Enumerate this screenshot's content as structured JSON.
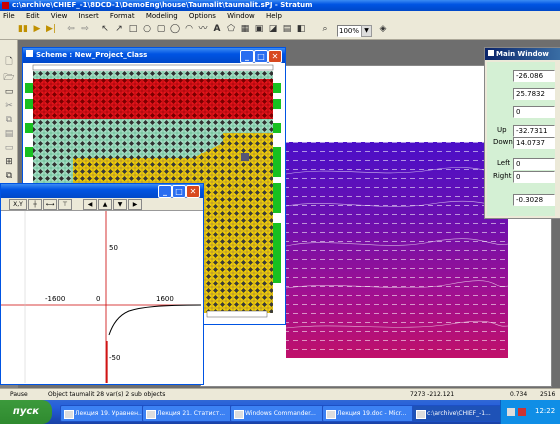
{
  "app": {
    "title": "c:\\archive\\CHIEF_-1\\8DCD-1\\DemoEng\\house\\Taumalit\\taumalit.sPJ - Stratum"
  },
  "menu": [
    "File",
    "Edit",
    "View",
    "Insert",
    "Format",
    "Modeling",
    "Options",
    "Window",
    "Help"
  ],
  "toolbar": {
    "zoom": "100%"
  },
  "scheme_window": {
    "title": "Scheme : New_Project_Class"
  },
  "graph_window": {
    "toolbar_label": "X,Y",
    "x_ticks": [
      "-1600",
      "0",
      "1600"
    ],
    "y_ticks": [
      "50",
      "-50"
    ]
  },
  "main_window": {
    "title": "Main Window",
    "fields": [
      {
        "label": "",
        "value": "-26.086"
      },
      {
        "label": "",
        "value": "25.7832"
      },
      {
        "label": "",
        "value": "0"
      },
      {
        "label": "Up",
        "value": "-32.7311"
      },
      {
        "label": "Down",
        "value": "14.0737"
      },
      {
        "label": "Left",
        "value": "0"
      },
      {
        "label": "Right",
        "value": "0"
      },
      {
        "label": "",
        "value": "-0.3028"
      }
    ]
  },
  "status": {
    "mode": "Pause",
    "object": "Object taumalit 28 var(s) 2 sub objects",
    "coords": "7273 -212.121",
    "val1": "0.734",
    "val2": "2516"
  },
  "taskbar": {
    "start": "пуск",
    "tasks": [
      "Лекция 19. Уравнен...",
      "Лекция 21. Статист...",
      "Windows Commander...",
      "Лекция 19.doc - Micr...",
      "c:\\archive\\CHIEF_-1..."
    ],
    "clock": "12:22"
  },
  "colors": {
    "red": "#e8141c",
    "yellow": "#f5d400",
    "teal": "#a9e0c8",
    "green": "#18c020",
    "purple": "#5010b0",
    "magenta": "#c01060"
  }
}
